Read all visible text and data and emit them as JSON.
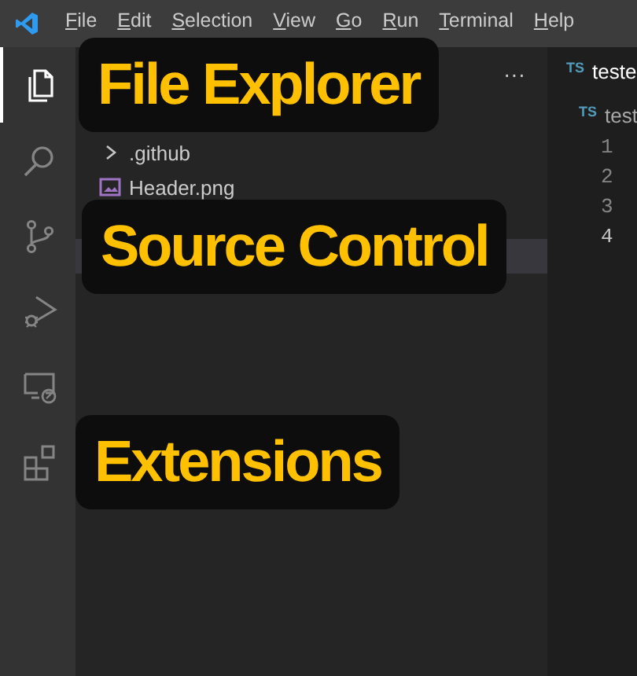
{
  "menu_bar": {
    "items": [
      "File",
      "Edit",
      "Selection",
      "View",
      "Go",
      "Run",
      "Terminal",
      "Help"
    ]
  },
  "activity_bar": {
    "items": [
      {
        "kind": "explorer",
        "selected": true
      },
      {
        "kind": "search",
        "selected": false
      },
      {
        "kind": "source-control",
        "selected": false
      },
      {
        "kind": "run-debug",
        "selected": false
      },
      {
        "kind": "remote",
        "selected": false
      },
      {
        "kind": "extensions",
        "selected": false
      }
    ]
  },
  "sidebar": {
    "more": "···",
    "items": [
      {
        "kind": "folder",
        "name": ".github",
        "expanded": false,
        "selected": false
      },
      {
        "kind": "image",
        "name": "Header.png",
        "selected": false
      },
      {
        "selected": false
      },
      {
        "selected": true
      }
    ]
  },
  "editor": {
    "tab": {
      "icon": "TS",
      "label": "teste"
    },
    "breadcrumb": {
      "icon": "TS",
      "label": "test"
    },
    "line_numbers": [
      {
        "number": "1",
        "current": false
      },
      {
        "number": "2",
        "current": false
      },
      {
        "number": "3",
        "current": false
      },
      {
        "number": "4",
        "current": true
      }
    ]
  },
  "callouts": [
    {
      "text": "File Explorer"
    },
    {
      "text": "Source Control"
    },
    {
      "text": "Extensions"
    }
  ]
}
